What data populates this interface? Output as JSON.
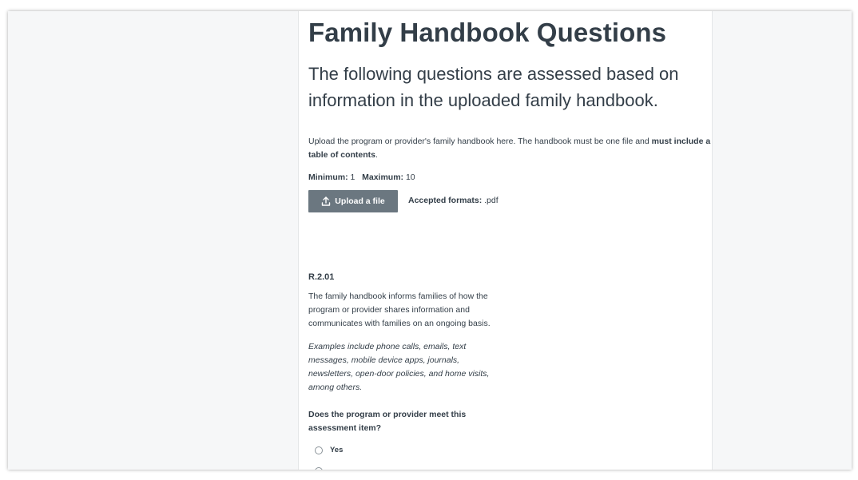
{
  "page": {
    "title": "Family Handbook Questions",
    "subtitle": "The following questions are assessed based on information in the uploaded family handbook."
  },
  "upload": {
    "instructions_prefix": "Upload the program or provider's family handbook here. The handbook must be one file and ",
    "instructions_bold": "must include a table of contents",
    "instructions_suffix": ".",
    "minimum_label": "Minimum:",
    "minimum_value": "1",
    "maximum_label": "Maximum:",
    "maximum_value": "10",
    "button_label": "Upload a file",
    "button_icon": "upload-icon",
    "accepted_label": "Accepted formats:",
    "accepted_value": ".pdf"
  },
  "item": {
    "code": "R.2.01",
    "description": "The family handbook informs families of how the program or provider shares information and communicates with families on an ongoing basis.",
    "examples": "Examples include phone calls, emails, text messages, mobile device apps, journals, newsletters, open-door policies, and home visits, among others.",
    "question": "Does the program or provider meet this assessment item?",
    "options": [
      "Yes"
    ]
  },
  "colors": {
    "text": "#333e48",
    "button": "#6b7780",
    "side_background": "#f6f7f8"
  }
}
